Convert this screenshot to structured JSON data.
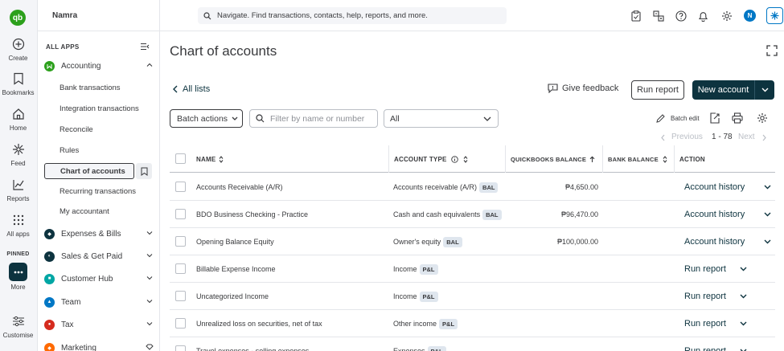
{
  "rail": {
    "logo": "qb",
    "items": [
      {
        "label": "Create",
        "icon": "plus-circle-icon"
      },
      {
        "label": "Bookmarks",
        "icon": "bookmark-icon"
      },
      {
        "label": "Home",
        "icon": "home-icon"
      },
      {
        "label": "Feed",
        "icon": "sparkle-icon"
      },
      {
        "label": "Reports",
        "icon": "reports-icon"
      },
      {
        "label": "All apps",
        "icon": "grid-icon"
      }
    ],
    "pinned_label": "PINNED",
    "more_label": "More",
    "customise_label": "Customise"
  },
  "sidebar": {
    "company": "Namra",
    "all_apps": "ALL APPS",
    "accounting": {
      "label": "Accounting",
      "items": [
        "Bank transactions",
        "Integration transactions",
        "Reconcile",
        "Rules",
        "Chart of accounts",
        "Recurring transactions",
        "My accountant"
      ]
    },
    "sections": [
      {
        "label": "Expenses & Bills",
        "color": "#0d333f"
      },
      {
        "label": "Sales & Get Paid",
        "color": "#0077c5"
      },
      {
        "label": "Customer Hub",
        "color": "#00a6a4"
      },
      {
        "label": "Team",
        "color": "#0077c5"
      },
      {
        "label": "Tax",
        "color": "#d52b1e"
      },
      {
        "label": "Marketing",
        "color": "#ff6a00"
      }
    ]
  },
  "topbar": {
    "search_placeholder": "Navigate. Find transactions, contacts, help, reports, and more.",
    "avatar": "N"
  },
  "page": {
    "title": "Chart of accounts",
    "all_lists": "All lists",
    "give_feedback": "Give feedback",
    "run_report": "Run report",
    "new_account": "New account",
    "batch_actions": "Batch actions",
    "filter_placeholder": "Filter by name or number",
    "type_select": "All",
    "batch_edit": "Batch edit",
    "pager": {
      "previous": "Previous",
      "range": "1 - 78",
      "next": "Next"
    }
  },
  "table": {
    "headers": {
      "name": "NAME",
      "type": "ACCOUNT TYPE",
      "qb_balance": "QUICKBOOKS BALANCE",
      "bank_balance": "BANK BALANCE",
      "action": "ACTION"
    },
    "rows": [
      {
        "name": "Accounts Receivable (A/R)",
        "type": "Accounts receivable (A/R)",
        "tag": "BAL",
        "qb_balance": "₱4,650.00",
        "action": "Account history"
      },
      {
        "name": "BDO Business Checking - Practice",
        "type": "Cash and cash equivalents",
        "tag": "BAL",
        "qb_balance": "₱96,470.00",
        "action": "Account history"
      },
      {
        "name": "Opening Balance Equity",
        "type": "Owner's equity",
        "tag": "BAL",
        "qb_balance": "₱100,000.00",
        "action": "Account history"
      },
      {
        "name": "Billable Expense Income",
        "type": "Income",
        "tag": "P&L",
        "qb_balance": "",
        "action": "Run report"
      },
      {
        "name": "Uncategorized Income",
        "type": "Income",
        "tag": "P&L",
        "qb_balance": "",
        "action": "Run report"
      },
      {
        "name": "Unrealized loss on securities, net of tax",
        "type": "Other income",
        "tag": "P&L",
        "qb_balance": "",
        "action": "Run report"
      },
      {
        "name": "Travel expenses - selling expenses",
        "type": "Expenses",
        "tag": "P&L",
        "qb_balance": "",
        "action": "Run report"
      }
    ]
  }
}
